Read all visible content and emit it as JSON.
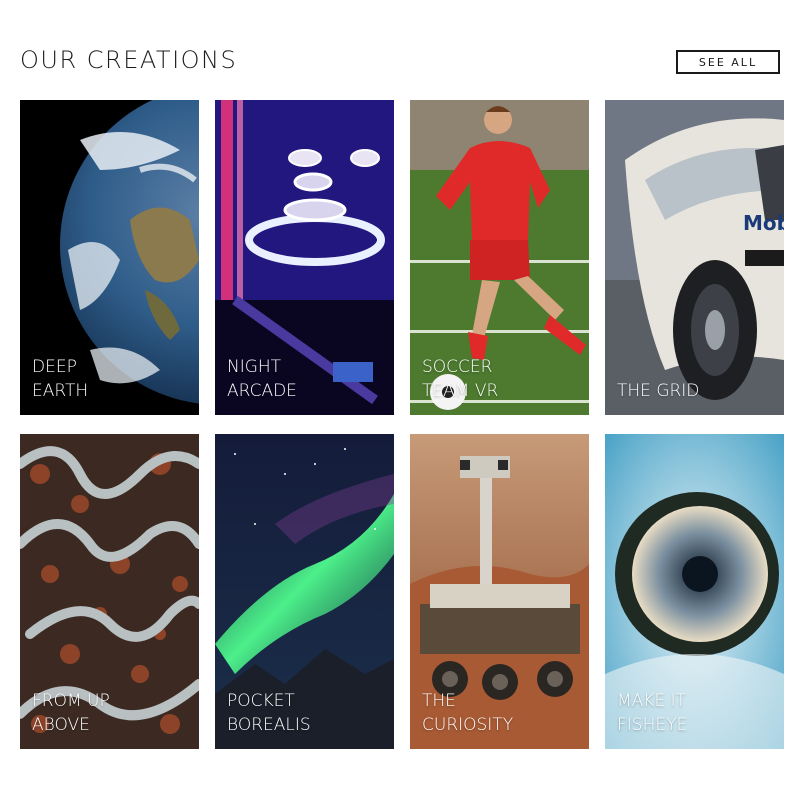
{
  "header": {
    "title": "OUR CREATIONS",
    "see_all_label": "SEE ALL"
  },
  "cards": [
    {
      "line1": "DEEP",
      "line2": "EARTH",
      "image": "earth-from-space"
    },
    {
      "line1": "NIGHT",
      "line2": "ARCADE",
      "image": "skee-ball-arcade"
    },
    {
      "line1": "SOCCER",
      "line2": "TEAM VR",
      "image": "soccer-player"
    },
    {
      "line1": "",
      "line2": "THE GRID",
      "image": "race-car"
    },
    {
      "line1": "FROM UP",
      "line2": "ABOVE",
      "image": "aerial-winding-road"
    },
    {
      "line1": "POCKET",
      "line2": "BOREALIS",
      "image": "northern-lights"
    },
    {
      "line1": "THE",
      "line2": "CURIOSITY",
      "image": "mars-rover"
    },
    {
      "line1": "MAKE IT",
      "line2": "FISHEYE",
      "image": "fisheye-planet"
    }
  ]
}
